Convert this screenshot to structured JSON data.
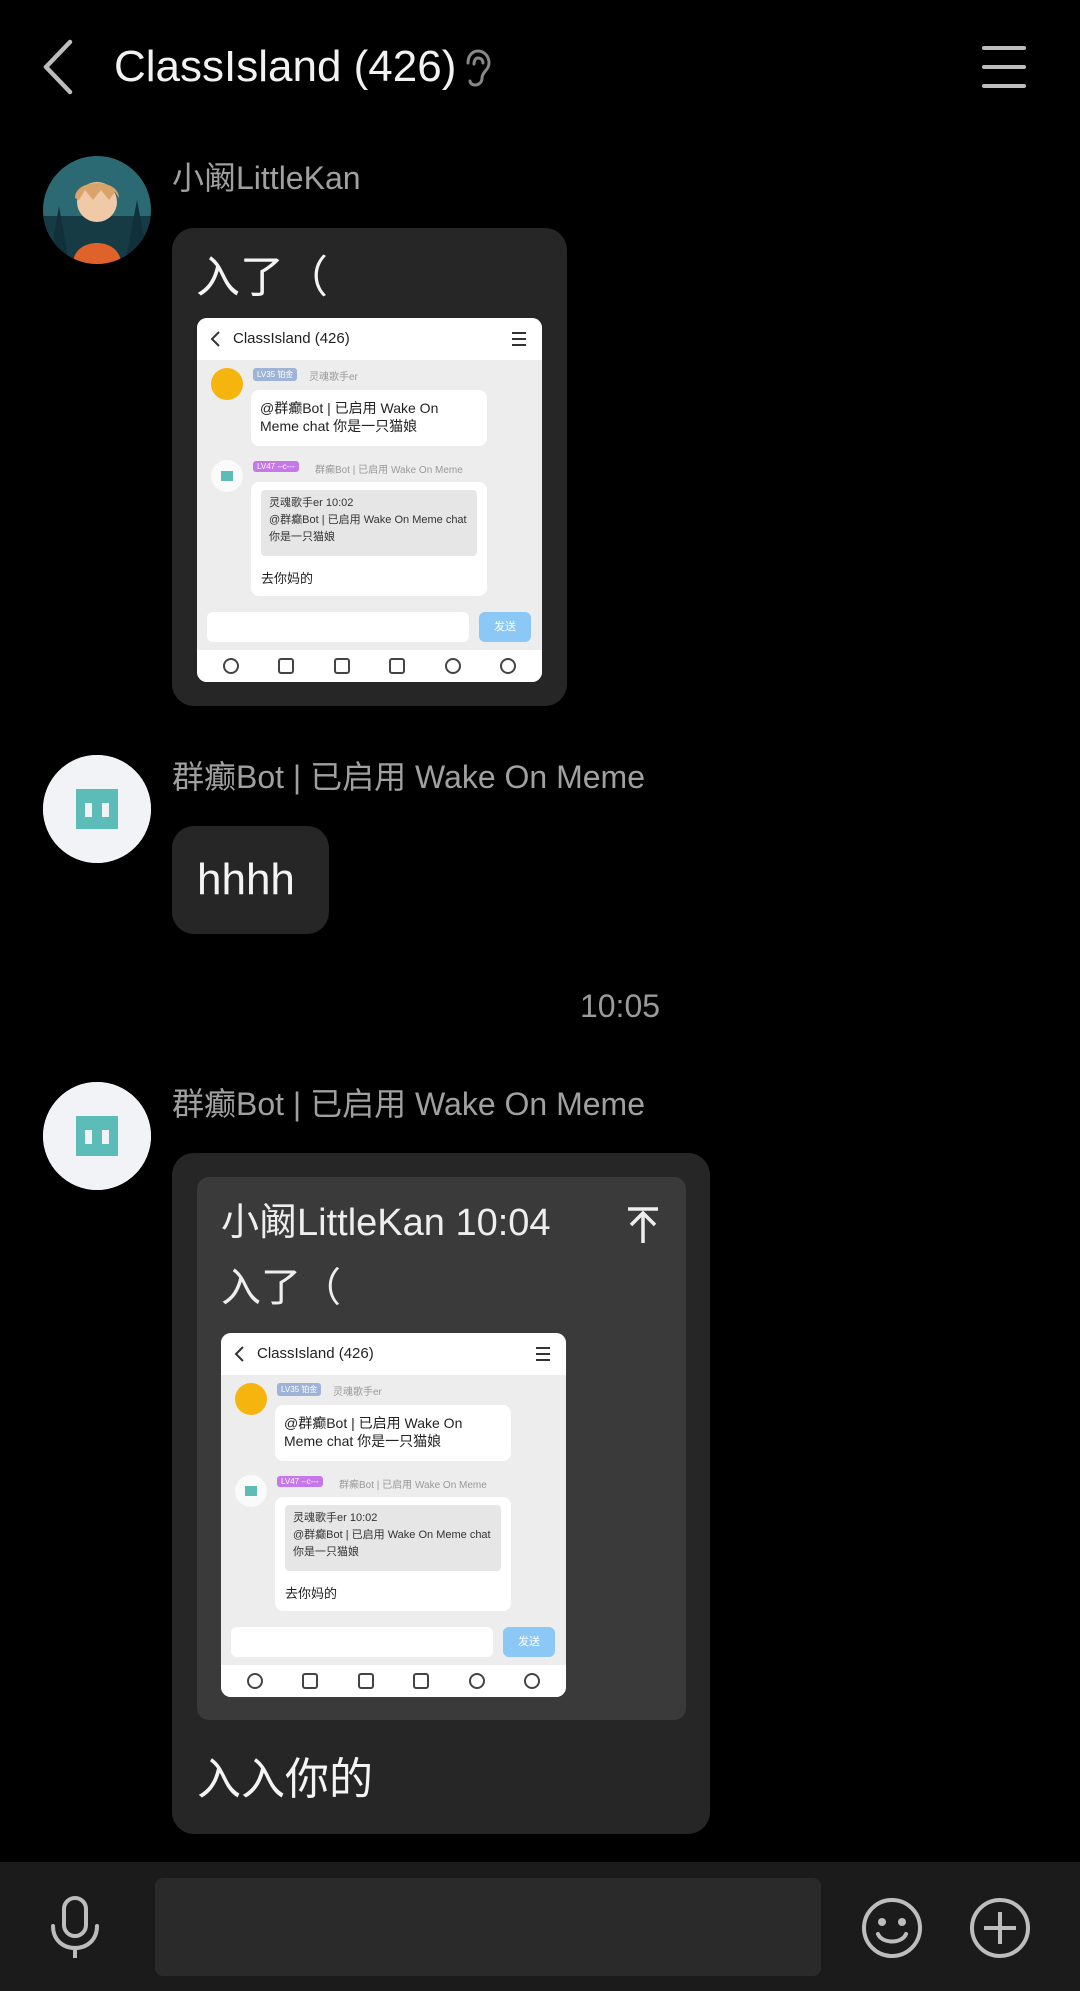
{
  "header": {
    "title": "ClassIsland (426)"
  },
  "messages": [
    {
      "sender": "小阚LittleKan",
      "text": "入了（",
      "image": {
        "title": "ClassIsland (426)",
        "badge1": "LV35 铂金",
        "name1": "灵魂歌手er",
        "msg1": "@群癫Bot | 已启用 Wake On Meme chat 你是一只猫娘",
        "badge2": "LV47 --c---",
        "name2": "群癫Bot | 已启用 Wake On Meme",
        "quote_head": "灵魂歌手er 10:02",
        "quote_body": "@群癫Bot | 已启用 Wake On Meme chat 你是一只猫娘",
        "reply": "去你妈的",
        "send": "发送"
      }
    },
    {
      "sender": "群癫Bot | 已启用 Wake On Meme",
      "text": "hhhh"
    },
    {
      "sender": "群癫Bot | 已启用 Wake On Meme",
      "quote_head": "小阚LittleKan 10:04",
      "quote_text": "入了（",
      "text": "入入你的"
    }
  ],
  "timestamp": "10:05",
  "icons": {
    "back": "chevron-left-icon",
    "ear": "ear-icon",
    "menu": "menu-icon",
    "mic": "microphone-icon",
    "emoji": "smiley-icon",
    "plus": "plus-circle-icon"
  }
}
